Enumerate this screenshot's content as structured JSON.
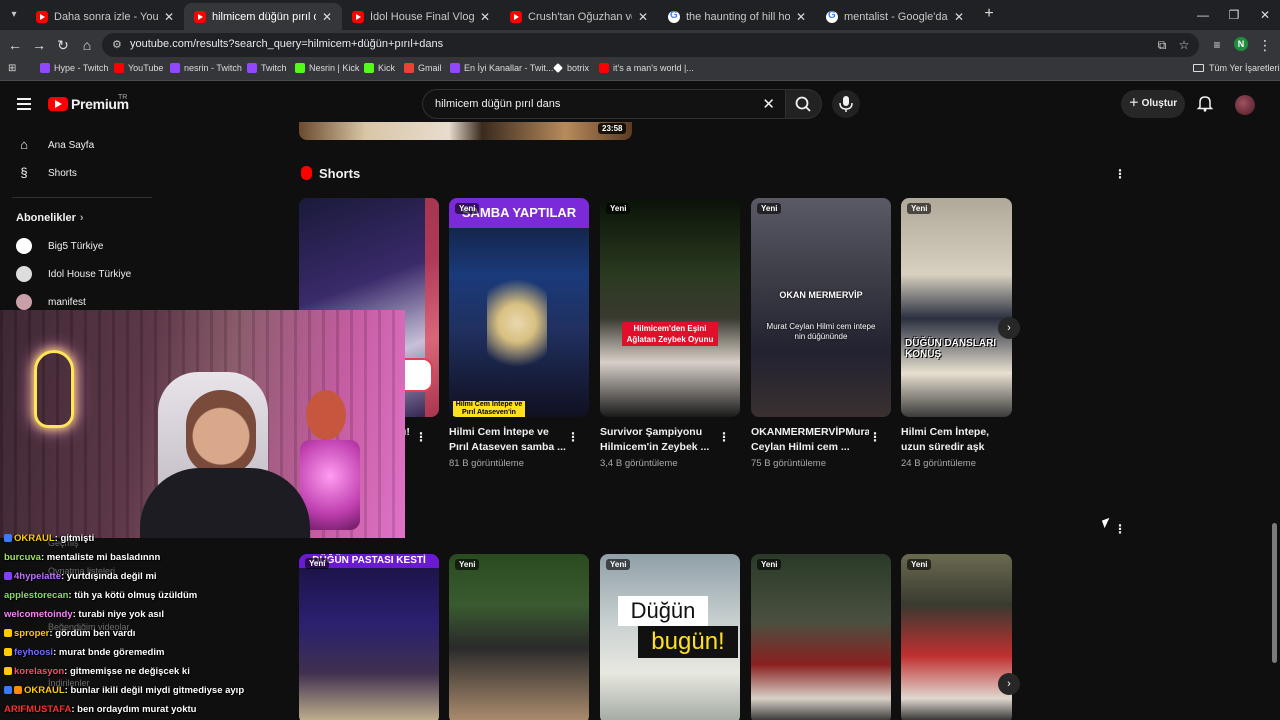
{
  "browser": {
    "tabs": [
      {
        "title": "Daha sonra izle - YouTube",
        "type": "yt",
        "active": false
      },
      {
        "title": "hilmicem düğün pırıl dans - YouT",
        "type": "yt",
        "active": true
      },
      {
        "title": "İdol House Final Vlog | Oğuzhan",
        "type": "yt",
        "active": false
      },
      {
        "title": "Crush'tan Oğuzhan ve Aura'dan",
        "type": "yt",
        "active": false
      },
      {
        "title": "the haunting of hill house - Goo",
        "type": "g",
        "active": false
      },
      {
        "title": "mentalist - Google'da Ara",
        "type": "g",
        "active": false
      }
    ],
    "url": "youtube.com/results?search_query=hilmicem+düğün+pırıl+dans",
    "profile_initial": "N",
    "bookmarks": [
      {
        "label": "Hype - Twitch",
        "icon": "tw"
      },
      {
        "label": "YouTube",
        "icon": "yt"
      },
      {
        "label": "nesrin - Twitch",
        "icon": "tw"
      },
      {
        "label": "Twitch",
        "icon": "tw"
      },
      {
        "label": "Nesrin | Kick",
        "icon": "kick"
      },
      {
        "label": "Kick",
        "icon": "kick"
      },
      {
        "label": "Gmail",
        "icon": "gm"
      },
      {
        "label": "En İyi Kanallar - Twit...",
        "icon": "tw"
      },
      {
        "label": "botrix",
        "icon": "bot"
      },
      {
        "label": "it's a man's world |...",
        "icon": "yt"
      }
    ],
    "all_bookmarks": "Tüm Yer İşaretleri"
  },
  "youtube": {
    "logo_text": "Premium",
    "region": "TR",
    "search_query": "hilmicem düğün pırıl dans",
    "create_label": "Oluştur",
    "sidebar": {
      "home": "Ana Sayfa",
      "shorts": "Shorts",
      "subscriptions_heading": "Abonelikler",
      "channels": [
        "Big5 Türkiye",
        "Idol House Türkiye",
        "manifest"
      ],
      "hidden_items": [
        "Geçmiş",
        "Oynatma listeleri",
        "Beğendiğim videolar",
        "İndirilenler"
      ]
    },
    "prev_video_duration": "23:58",
    "shorts_heading": "Shorts",
    "shorts_row1": [
      {
        "title": "…dü!",
        "views": "",
        "new": false,
        "overlay": ""
      },
      {
        "title": "Hilmi Cem İntepe ve Pırıl Ataseven samba ...",
        "views": "81 B görüntüleme",
        "new": true,
        "overlay": "SAMBA YAPTILAR",
        "overlay2": "Hilmi Cem İntepe ve Pırıl Ataseven'in"
      },
      {
        "title": "Survivor Şampiyonu Hilmicem'in Zeybek ...",
        "views": "3,4 B görüntüleme",
        "new": true,
        "overlay": "Hilmicem'den Eşini Ağlatan Zeybek Oyunu"
      },
      {
        "title": "OKANMERMERVİPMurat Ceylan Hilmi cem ...",
        "views": "75 B görüntüleme",
        "new": true,
        "overlay": "OKAN MERMERVİP",
        "overlay2": "Murat Ceylan Hilmi cem intepe nin düğününde"
      },
      {
        "title": "Hilmi Cem İntepe, uzun süredir aşk yaşadığı ...",
        "views": "24 B görüntüleme",
        "new": true,
        "overlay": "DÜĞÜN DANSLARI KONUŞ"
      }
    ],
    "shorts_row2": [
      {
        "new": true,
        "overlay": "DÜĞÜN PASTASI KESTİ"
      },
      {
        "new": true,
        "overlay": ""
      },
      {
        "new": true,
        "overlay": "Düğün",
        "overlay2": "bugün!"
      },
      {
        "new": true,
        "overlay": ""
      },
      {
        "new": true,
        "overlay": ""
      }
    ]
  },
  "chat": [
    {
      "user": "OKRAUL",
      "msg": ": gitmişti",
      "color": "#ffcc00"
    },
    {
      "user": "burcuva",
      "msg": ": mentaliste mi basladınnn",
      "color": "#a0e060"
    },
    {
      "user": "4hypelatte",
      "msg": ": yurtdışında değil mi",
      "color": "#c070ff"
    },
    {
      "user": "applestorecan",
      "msg": ": tüh ya kötü olmuş üzüldüm",
      "color": "#80e060"
    },
    {
      "user": "welcometoindy",
      "msg": ": turabi niye yok asıl",
      "color": "#ff80ff"
    },
    {
      "user": "sproper",
      "msg": ": gördüm ben vardı",
      "color": "#ffcc00"
    },
    {
      "user": "feyhoosi",
      "msg": ": murat bnde göremedim",
      "color": "#7070ff"
    },
    {
      "user": "korelasyon",
      "msg": ": gitmemişse ne değişcek ki",
      "color": "#ff4a6a"
    },
    {
      "user": "OKRAUL",
      "msg": ": bunlar ikili değil miydi gitmediyse ayıp",
      "color": "#ffcc00"
    },
    {
      "user": "ARIFMUSTAFA",
      "msg": ": ben ordaydım murat yoktu",
      "color": "#ff3030"
    }
  ]
}
